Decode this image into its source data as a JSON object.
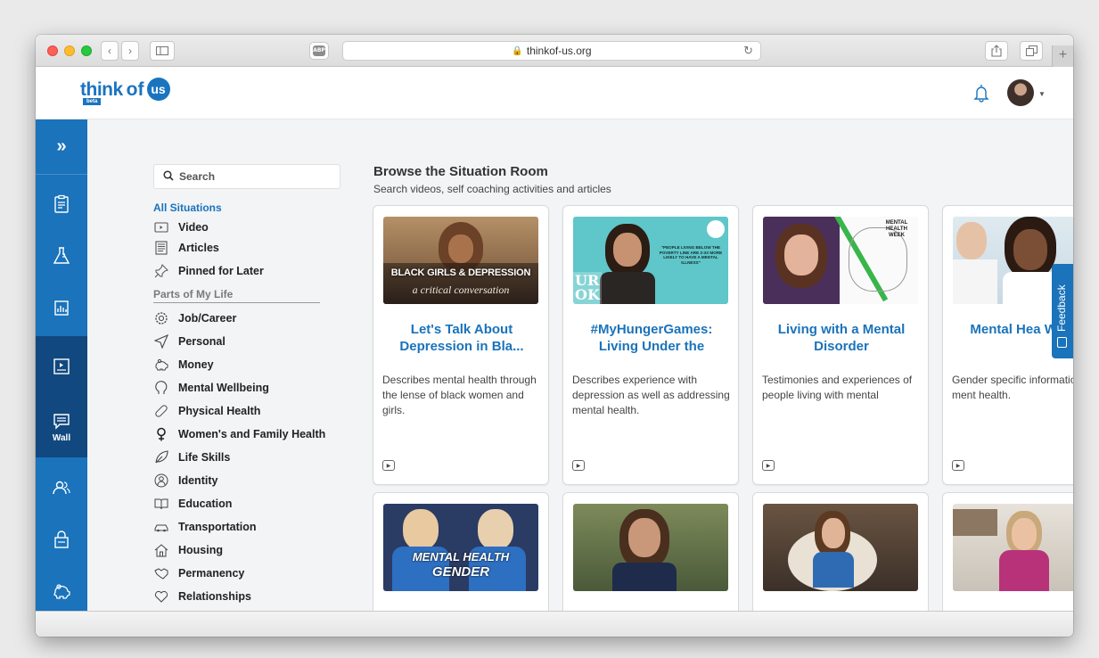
{
  "browser": {
    "url": "thinkof-us.org",
    "abp_label": "ABP"
  },
  "site": {
    "logo_think": "think",
    "logo_beta": "beta",
    "logo_of": "of",
    "logo_us": "us"
  },
  "rail": {
    "wall_label": "Wall"
  },
  "sidebar": {
    "search_placeholder": "Search",
    "all_situations": "All Situations",
    "top_items": [
      {
        "label": "Video",
        "icon": "video-icon"
      },
      {
        "label": "Articles",
        "icon": "article-icon"
      },
      {
        "label": "Pinned for Later",
        "icon": "pin-icon"
      }
    ],
    "parts_heading": "Parts of My Life",
    "parts": [
      {
        "label": "Job/Career",
        "icon": "gear-icon"
      },
      {
        "label": "Personal",
        "icon": "send-icon"
      },
      {
        "label": "Money",
        "icon": "piggy-bank-icon"
      },
      {
        "label": "Mental Wellbeing",
        "icon": "head-icon"
      },
      {
        "label": "Physical Health",
        "icon": "bandage-icon"
      },
      {
        "label": "Women's and Family Health",
        "icon": "female-icon"
      },
      {
        "label": "Life Skills",
        "icon": "leaf-icon"
      },
      {
        "label": "Identity",
        "icon": "person-icon"
      },
      {
        "label": "Education",
        "icon": "book-icon"
      },
      {
        "label": "Transportation",
        "icon": "car-icon"
      },
      {
        "label": "Housing",
        "icon": "house-icon"
      },
      {
        "label": "Permanency",
        "icon": "handshake-icon"
      },
      {
        "label": "Relationships",
        "icon": "heart-icon"
      }
    ]
  },
  "main": {
    "title": "Browse the Situation Room",
    "subtitle": "Search videos, self coaching activities and articles",
    "cards": [
      {
        "title": "Let's Talk About Depression in Bla...",
        "description": "Describes mental health through the lense of black women and girls.",
        "thumb_line1": "BLACK GIRLS & DEPRESSION",
        "thumb_line2": "a critical conversation"
      },
      {
        "title": "#MyHungerGames: Living Under the",
        "description": "Describes experience with depression as well as addressing mental health.",
        "thumb_line1": "UR OK",
        "thumb_line2": "\"PEOPLE LIVING BELOW THE POVERTY LINE ARE 2-3X MORE LIKELY TO HAVE A MENTAL ILLNESS\""
      },
      {
        "title": "Living with a Mental Disorder",
        "description": "Testimonies and experiences of people living with mental",
        "thumb_line1": "MENTAL HEALTH WEEK"
      },
      {
        "title": "Mental Hea Women",
        "description": "Gender specific information on ment health."
      }
    ],
    "row2": [
      {
        "thumb_line1": "MENTAL HEALTH",
        "thumb_line2": "GENDER"
      },
      {},
      {},
      {}
    ]
  },
  "feedback_label": "Feedback"
}
